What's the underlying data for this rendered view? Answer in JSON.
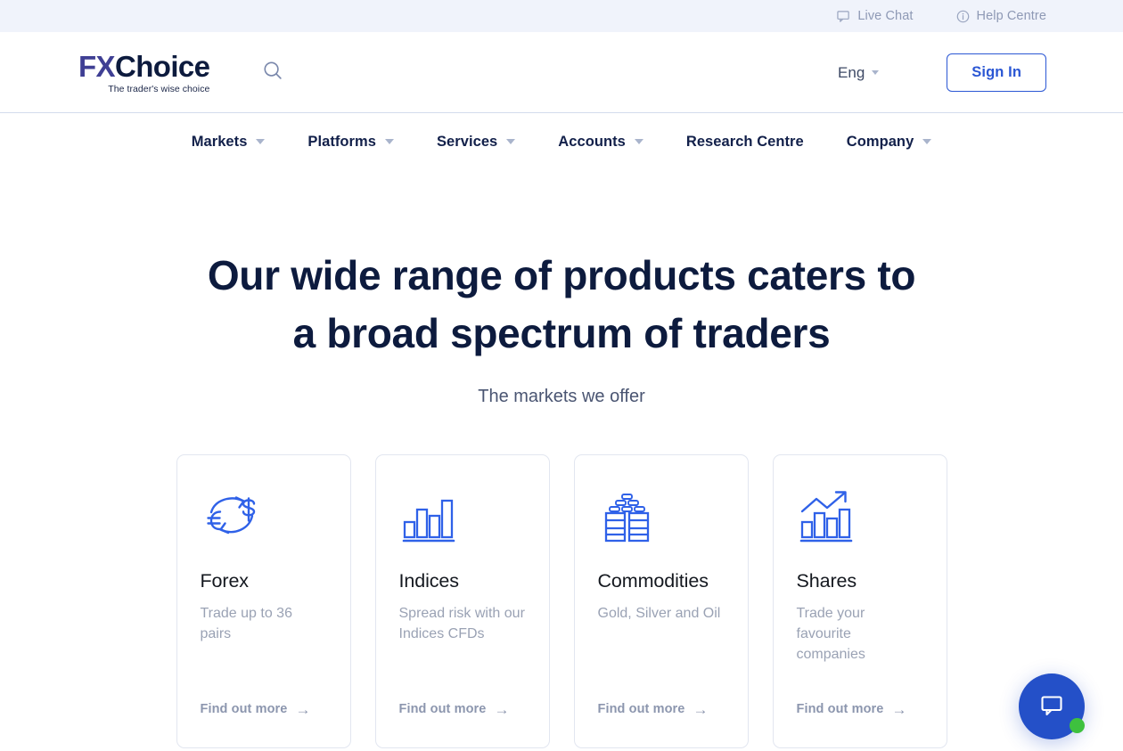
{
  "topbar": {
    "live_chat": "Live Chat",
    "help_centre": "Help Centre"
  },
  "header": {
    "logo_fx": "FX",
    "logo_choice": "Choice",
    "tagline": "The trader's wise choice",
    "language": "Eng",
    "sign_in": "Sign In"
  },
  "nav": {
    "items": [
      {
        "label": "Markets",
        "has_caret": true
      },
      {
        "label": "Platforms",
        "has_caret": true
      },
      {
        "label": "Services",
        "has_caret": true
      },
      {
        "label": "Accounts",
        "has_caret": true
      },
      {
        "label": "Research Centre",
        "has_caret": false
      },
      {
        "label": "Company",
        "has_caret": true
      }
    ]
  },
  "hero": {
    "title_line1": "Our wide range of products caters to",
    "title_line2": "a broad spectrum of traders",
    "subtitle": "The markets we offer"
  },
  "cards": [
    {
      "icon": "currency-exchange-icon",
      "title": "Forex",
      "description": "Trade up to 36 pairs",
      "link_label": "Find out more",
      "link_arrow": "→"
    },
    {
      "icon": "bar-chart-icon",
      "title": "Indices",
      "description": "Spread risk with our Indices CFDs",
      "link_label": "Find out more",
      "link_arrow": "→"
    },
    {
      "icon": "oil-barrels-gold-bars-icon",
      "title": "Commodities",
      "description": "Gold, Silver and Oil",
      "link_label": "Find out more",
      "link_arrow": "→"
    },
    {
      "icon": "growth-chart-icon",
      "title": "Shares",
      "description": "Trade your favourite companies",
      "link_label": "Find out more",
      "link_arrow": "→"
    }
  ],
  "chat_widget": {
    "icon": "chat-bubble-icon",
    "status": "online"
  },
  "colors": {
    "brand_purple": "#3f3f94",
    "brand_navy": "#0d1b3e",
    "accent_blue": "#2b57d4",
    "icon_blue": "#2f61e8",
    "topbar_bg": "#f0f3fb",
    "muted_text": "#9aa2b4",
    "status_green": "#3ec13e"
  }
}
